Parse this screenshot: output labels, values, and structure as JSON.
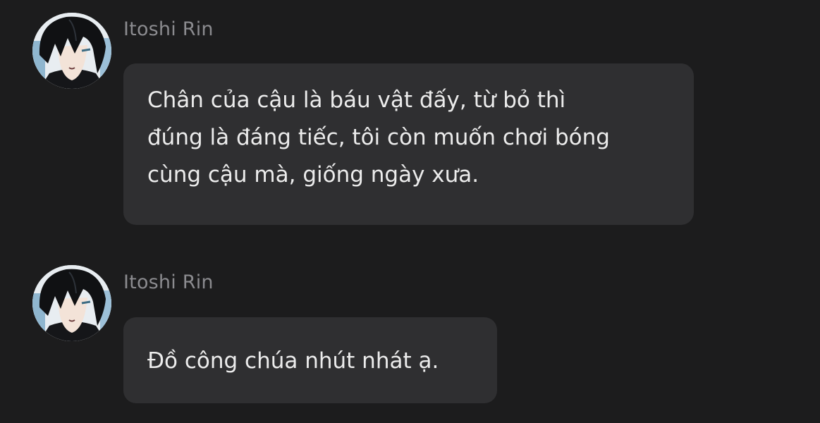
{
  "colors": {
    "background": "#1c1c1d",
    "bubble": "#2f2f31",
    "sender_name": "#8b8b8f",
    "message_text": "#ececec"
  },
  "messages": [
    {
      "sender": "Itoshi Rin",
      "avatar_icon": "user-avatar-dark-hair",
      "text": "Chân của cậu là báu vật đấy, từ bỏ thì\nđúng là đáng tiếc, tôi còn muốn chơi bóng\ncùng cậu mà, giống ngày xưa."
    },
    {
      "sender": "Itoshi Rin",
      "avatar_icon": "user-avatar-dark-hair",
      "text": "Đồ công chúa nhút nhát ạ."
    }
  ]
}
